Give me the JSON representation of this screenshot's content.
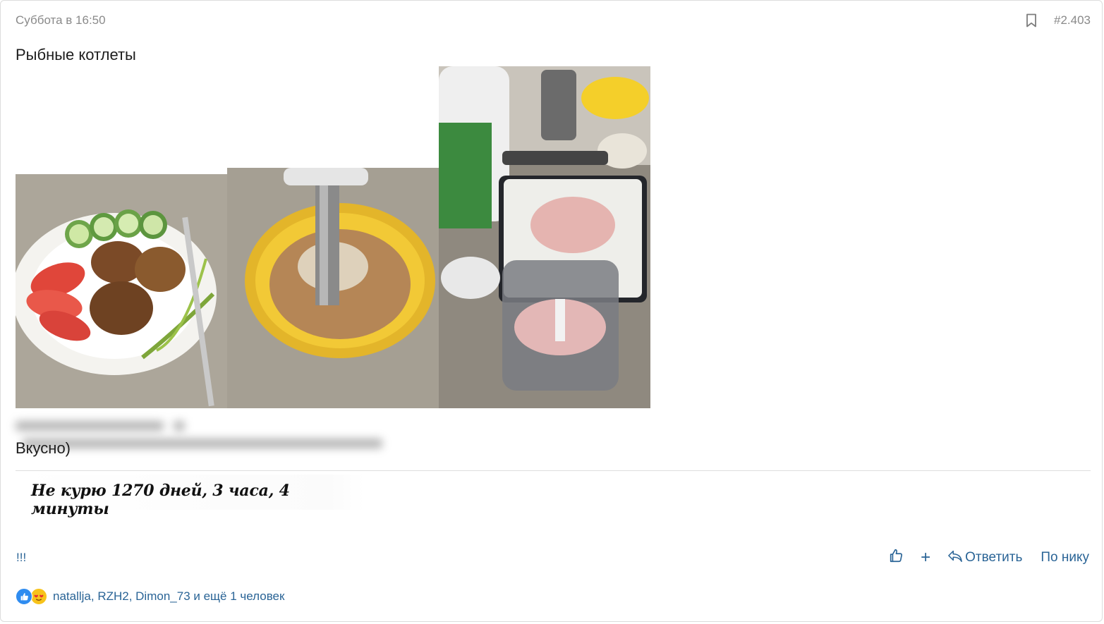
{
  "post": {
    "timestamp": "Суббота в 16:50",
    "post_number": "#2.403",
    "title": "Рыбные котлеты",
    "body": "Вкусно)",
    "signature": "Не курю 1270 дней, 3 часа, 4 минуты",
    "exclaim": "!!!"
  },
  "photos": [
    {
      "name": "fish-cutlets-plate"
    },
    {
      "name": "mixing-bowl-blender"
    },
    {
      "name": "kitchen-ingredients"
    }
  ],
  "actions": {
    "like_icon": "thumbs-up-icon",
    "plus_label": "+",
    "reply_label": "Ответить",
    "by_nick_label": "По нику"
  },
  "reactions": {
    "users": "natallja, RZH2, Dimon_73",
    "more": " и ещё 1 человек"
  },
  "colors": {
    "link": "#2a6496",
    "meta": "#8a8a8a",
    "like": "#2f8cf0",
    "love": "#f7c31b"
  }
}
